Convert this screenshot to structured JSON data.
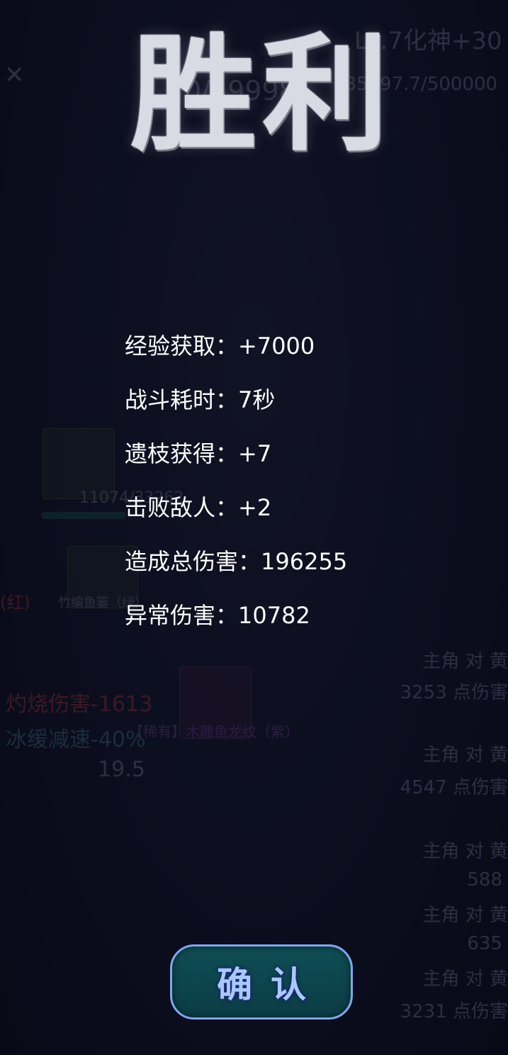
{
  "title": "胜利",
  "stats": [
    {
      "label": "经验获取：",
      "value": "+7000"
    },
    {
      "label": "战斗耗时：",
      "value": "7秒"
    },
    {
      "label": "遗枝获得：",
      "value": "+7"
    },
    {
      "label": "击败敌人：",
      "value": "+2"
    },
    {
      "label": "造成总伤害：",
      "value": "196255"
    },
    {
      "label": "异常伤害：",
      "value": "10782"
    }
  ],
  "confirm_label": "确认",
  "background": {
    "level_text": "Lv.7化神+30",
    "exp_text": "135397.7/500000",
    "hp_fraction": "0/39998",
    "enemy_hp": "11074/33262",
    "item1": "竹编鱼篓（绿）",
    "item2": "【稀有】木雕鱼龙纹（紫）",
    "tag_red": "(红)",
    "burn": "灼烧伤害-1613",
    "slow": "冰缓减速-40%",
    "stat_val": "19.5",
    "log": [
      {
        "line1": "主角 对 黄",
        "line2": "3253 点伤害"
      },
      {
        "line1": "主角 对 黄",
        "line2": "4547 点伤害"
      },
      {
        "line1": "主角 对 黄",
        "line2": "588"
      },
      {
        "line1": "主角 对 黄",
        "line2": "635"
      },
      {
        "line1": "主角 对 黄",
        "line2": "3231 点伤害"
      }
    ]
  }
}
